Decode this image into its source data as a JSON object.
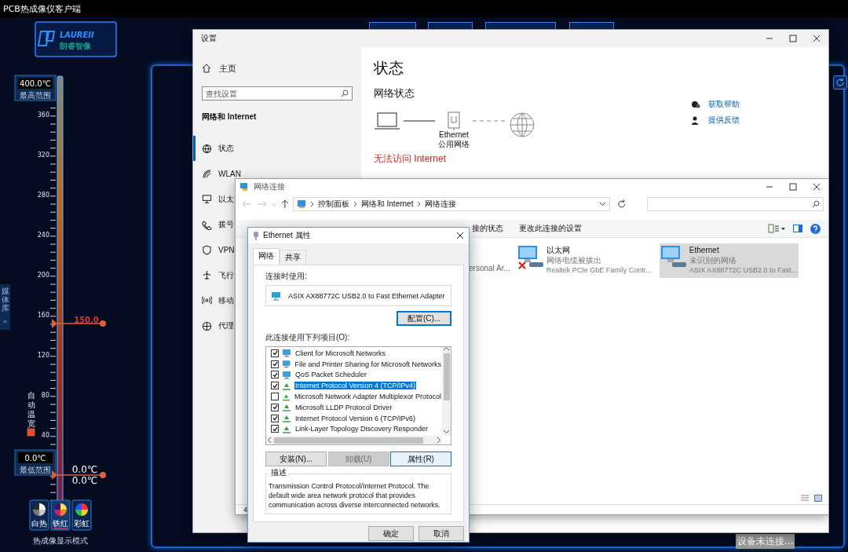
{
  "app": {
    "title": "PCB热成像仪客户端",
    "logo": {
      "brand": "LAUREII",
      "name": "朗睿智像"
    },
    "side_tab": {
      "label": "媒体库",
      "arrow": "»"
    },
    "scale": {
      "max": "400.0℃",
      "max_label": "最高范围",
      "ticks": [
        "360",
        "320",
        "280",
        "240",
        "200",
        "160",
        "120",
        "80",
        "40"
      ],
      "marker": "150.0",
      "min": "0.0℃",
      "min_label": "最低范围",
      "readouts": [
        "0.0℃",
        "0.0℃"
      ]
    },
    "auto_range": {
      "label": "自动温宽",
      "checked": true
    },
    "palettes": [
      {
        "label": "白热",
        "kind": "white",
        "selected": false
      },
      {
        "label": "铁红",
        "kind": "iron",
        "selected": true
      },
      {
        "label": "彩虹",
        "kind": "rainbow",
        "selected": false
      }
    ],
    "palette_caption": "热成像显示模式",
    "status": "设备未连接..."
  },
  "settings": {
    "title": "设置",
    "home": "主页",
    "search_placeholder": "查找设置",
    "section": "网络和 Internet",
    "nav": [
      {
        "label": "状态",
        "kind": "status",
        "selected": true
      },
      {
        "label": "WLAN",
        "kind": "wifi",
        "selected": false
      },
      {
        "label": "以太",
        "kind": "ethernet",
        "selected": false
      },
      {
        "label": "拨号",
        "kind": "dialup",
        "selected": false
      },
      {
        "label": "VPN",
        "kind": "vpn",
        "selected": false
      },
      {
        "label": "飞行",
        "kind": "airplane",
        "selected": false
      },
      {
        "label": "移动",
        "kind": "hotspot",
        "selected": false
      },
      {
        "label": "代理",
        "kind": "proxy",
        "selected": false
      }
    ],
    "heading": "状态",
    "subheading": "网络状态",
    "adapter_name": "Ethernet",
    "network_type": "公用网络",
    "alert": "无法访问 Internet",
    "links": [
      {
        "label": "获取帮助",
        "kind": "help"
      },
      {
        "label": "提供反馈",
        "kind": "feedback"
      }
    ]
  },
  "connections": {
    "title": "网络连接",
    "breadcrumb": [
      "控制面板",
      "网络和 Internet",
      "网络连接"
    ],
    "commands": [
      "接的状态",
      "更改此连接的设置"
    ],
    "partial_item": "ersonal Ar...",
    "adapters": [
      {
        "name": "以太网",
        "status": "网络电缆被拔出",
        "device": "Realtek PCIe GbE Family Contr...",
        "disconnected": true,
        "selected": false
      },
      {
        "name": "Ethernet",
        "status": "未识别的网络",
        "device": "ASIX AX88772C USB2.0 to Fast...",
        "disconnected": false,
        "selected": true
      }
    ],
    "status_bar": "4"
  },
  "dialog": {
    "title": "Ethernet 属性",
    "tabs": [
      {
        "label": "网络",
        "selected": true
      },
      {
        "label": "共享",
        "selected": false
      }
    ],
    "connect_using_label": "连接时使用:",
    "adapter": "ASIX AX88772C USB2.0 to Fast Ethernet Adapter",
    "configure": "配置(C)...",
    "items_label": "此连接使用下列项目(O):",
    "items": [
      {
        "label": "Client for Microsoft Networks",
        "kind": "service",
        "checked": true,
        "selected": false
      },
      {
        "label": "File and Printer Sharing for Microsoft Networks",
        "kind": "service",
        "checked": true,
        "selected": false
      },
      {
        "label": "QoS Packet Scheduler",
        "kind": "service",
        "checked": true,
        "selected": false
      },
      {
        "label": "Internet Protocol Version 4 (TCP/IPv4)",
        "kind": "protocol",
        "checked": true,
        "selected": true
      },
      {
        "label": "Microsoft Network Adapter Multiplexor Protocol",
        "kind": "protocol",
        "checked": false,
        "selected": false
      },
      {
        "label": "Microsoft LLDP Protocol Driver",
        "kind": "protocol",
        "checked": true,
        "selected": false
      },
      {
        "label": "Internet Protocol Version 6 (TCP/IPv6)",
        "kind": "protocol",
        "checked": true,
        "selected": false
      },
      {
        "label": "Link-Layer Topology Discovery Responder",
        "kind": "protocol",
        "checked": true,
        "selected": false
      }
    ],
    "buttons": [
      {
        "label": "安装(N)...",
        "disabled": false
      },
      {
        "label": "卸载(U)",
        "disabled": true
      },
      {
        "label": "属性(R)",
        "disabled": false
      }
    ],
    "description_label": "描述",
    "description": "Transmission Control Protocol/Internet Protocol. The default wide area network protocol that provides communication across diverse interconnected networks.",
    "ok": "确定",
    "cancel": "取消"
  }
}
